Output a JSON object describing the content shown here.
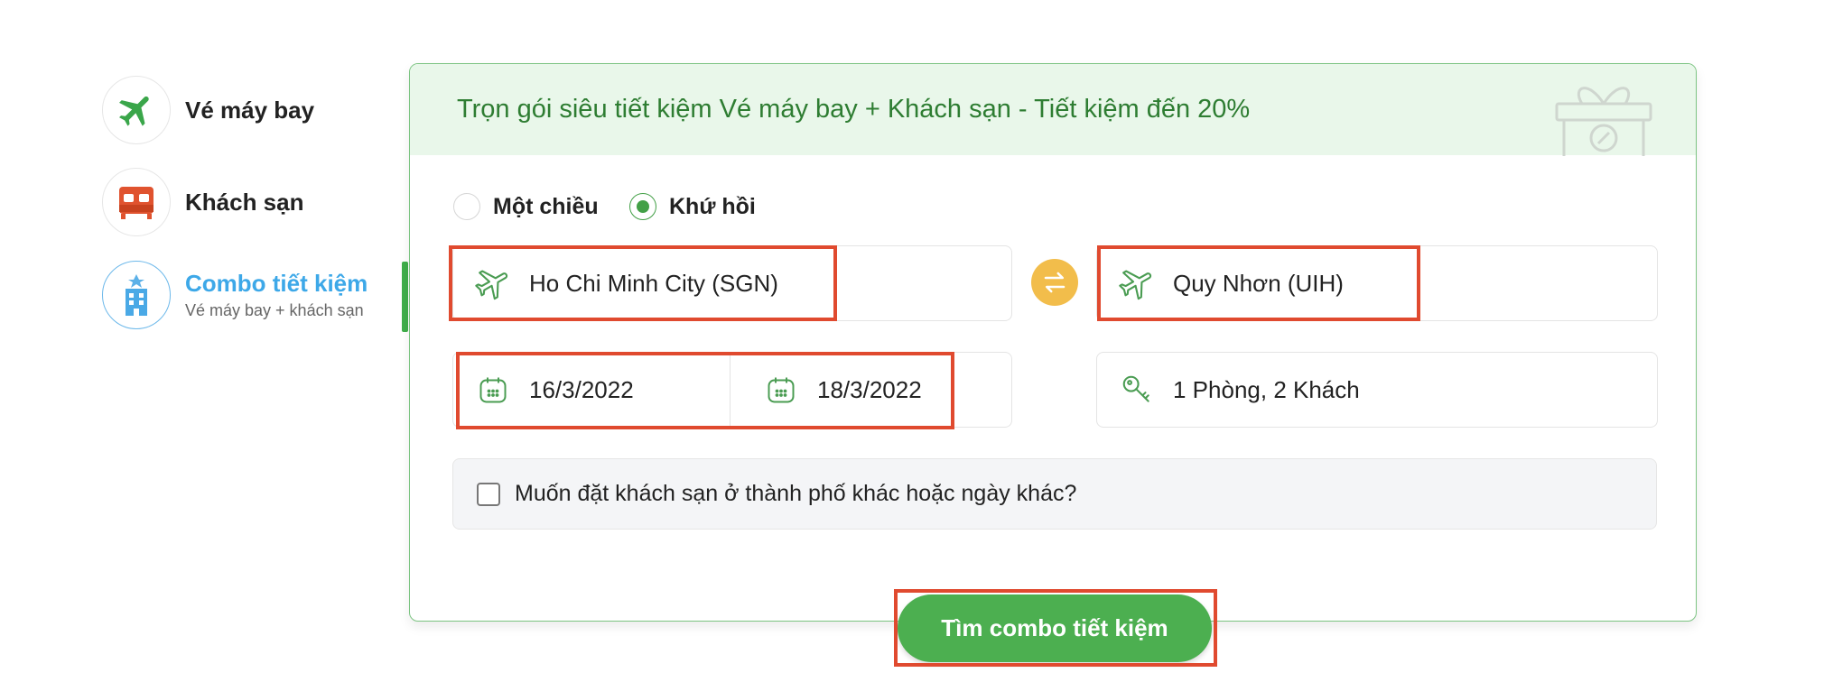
{
  "sidebar": {
    "items": [
      {
        "label": "Vé máy bay",
        "icon": "airplane-icon"
      },
      {
        "label": "Khách sạn",
        "icon": "bed-icon"
      },
      {
        "label": "Combo tiết kiệm",
        "sublabel": "Vé máy bay + khách sạn",
        "icon": "hotel-plane-icon",
        "active": true
      }
    ]
  },
  "card": {
    "title": "Trọn gói siêu tiết kiệm Vé máy bay + Khách sạn - Tiết kiệm đến 20%",
    "trip_type": {
      "options": [
        "Một chiều",
        "Khứ hồi"
      ],
      "selected": "Khứ hồi"
    },
    "origin": "Ho Chi Minh City (SGN)",
    "destination": "Quy Nhơn (UIH)",
    "depart_date": "16/3/2022",
    "return_date": "18/3/2022",
    "rooms_guests": "1 Phòng, 2 Khách",
    "other_hotel_checkbox": {
      "label": "Muốn đặt khách sạn ở thành phố khác hoặc ngày khác?",
      "checked": false
    },
    "search_button": "Tìm combo tiết kiệm"
  },
  "colors": {
    "accent_green": "#4caf50",
    "title_green": "#2e7d32",
    "active_blue": "#3da8e8",
    "swap_yellow": "#f2bd4b",
    "annotation_red": "#e04a2f"
  }
}
